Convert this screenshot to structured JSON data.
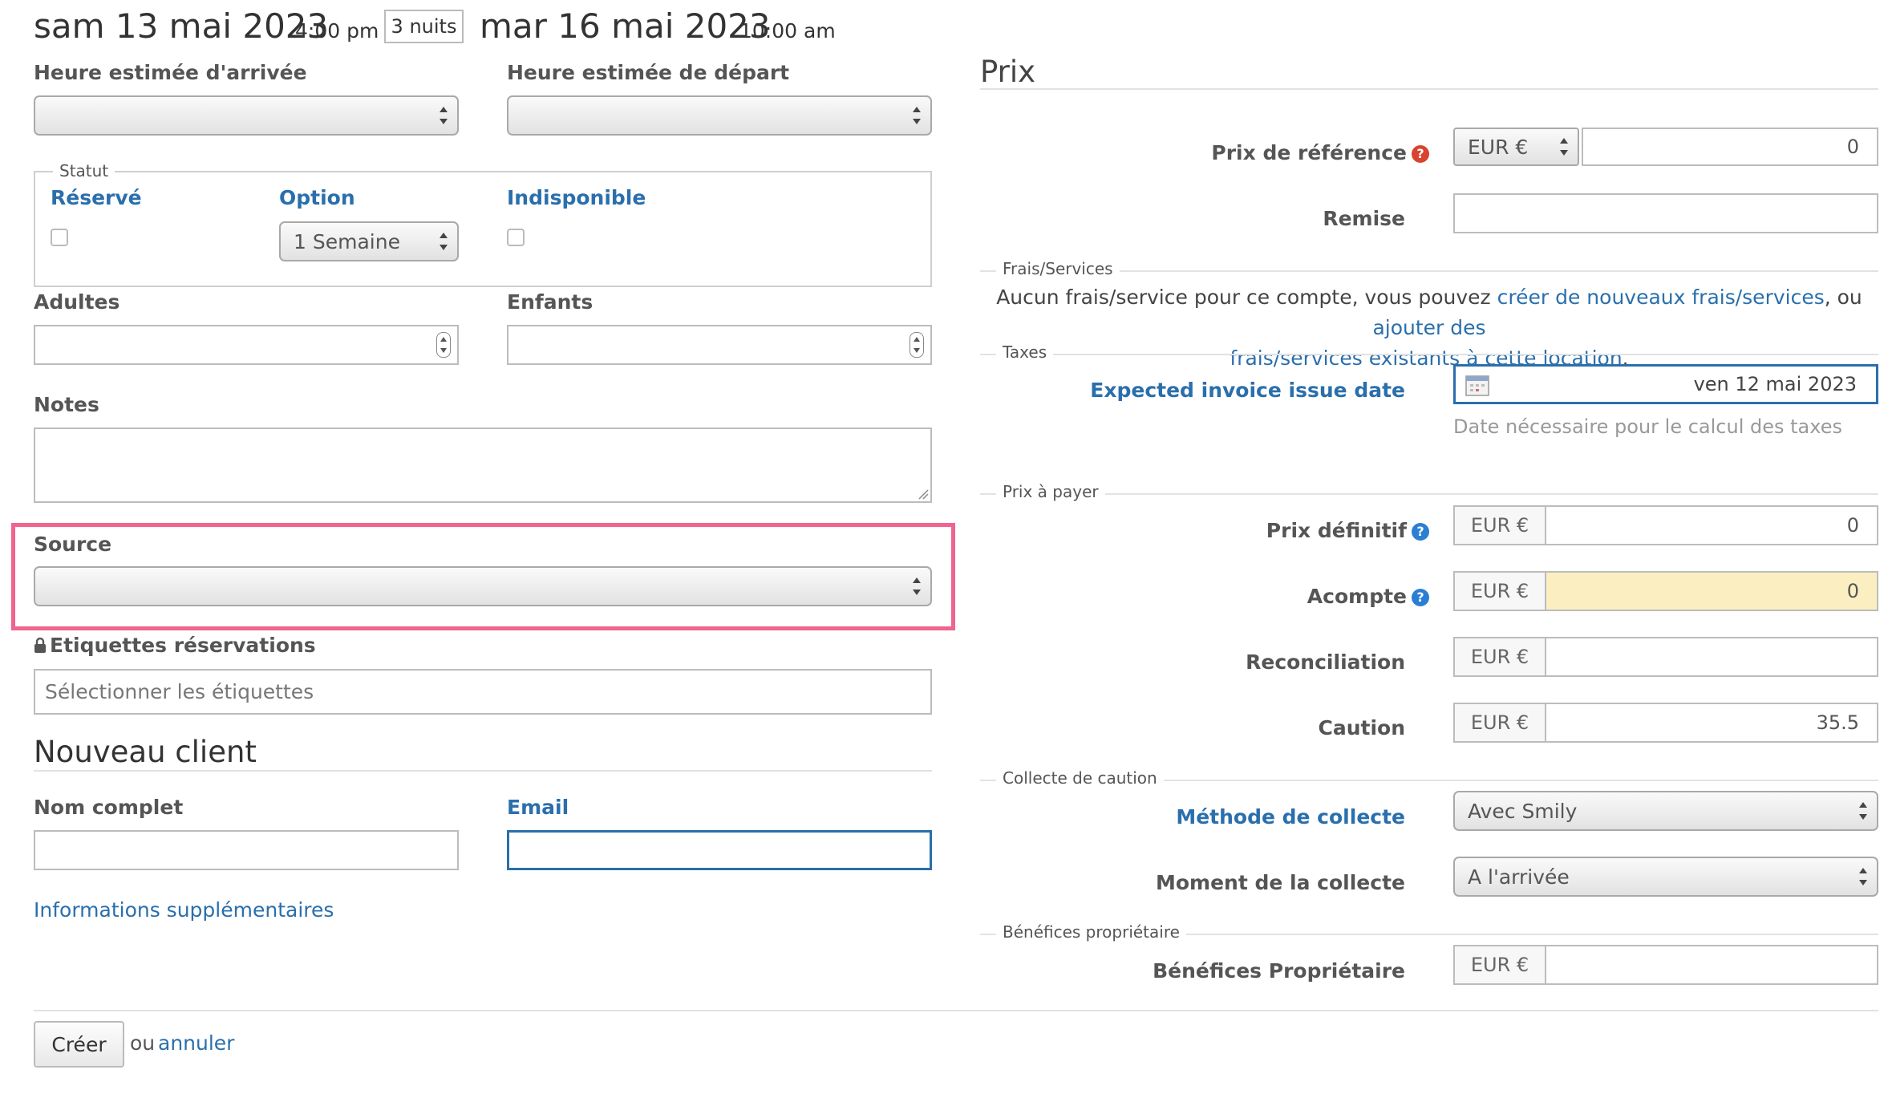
{
  "header": {
    "arrival_date": "sam 13 mai 2023",
    "arrival_time": "4:00 pm",
    "nights": "3 nuits",
    "departure_date": "mar 16 mai 2023",
    "departure_time": "10:00 am"
  },
  "left": {
    "arrival_time_label": "Heure estimée d'arrivée",
    "departure_time_label": "Heure estimée de départ",
    "status_legend": "Statut",
    "status_reserved": "Réservé",
    "status_option": "Option",
    "option_select_value": "1 Semaine",
    "status_unavailable": "Indisponible",
    "adults_label": "Adultes",
    "children_label": "Enfants",
    "notes_label": "Notes",
    "source_label": "Source",
    "tags_label": "Etiquettes réservations",
    "tags_placeholder": "Sélectionner les étiquettes",
    "new_client_title": "Nouveau client",
    "fullname_label": "Nom complet",
    "email_label": "Email",
    "more_info_link": "Informations supplémentaires"
  },
  "footer": {
    "create_button": "Créer",
    "or_text": "ou",
    "cancel_link": "annuler"
  },
  "right": {
    "title": "Prix",
    "ref_price_label": "Prix de référence",
    "ref_currency": "EUR €",
    "ref_price_value": "0",
    "discount_label": "Remise",
    "fees_legend": "Frais/Services",
    "fees_text_1": "Aucun frais/service pour ce compte, vous pouvez ",
    "fees_link_1": "créer de nouveaux frais/services",
    "fees_text_2": ", ou ",
    "fees_link_2a": "ajouter des",
    "fees_link_2b": "frais/services existants à cette location",
    "fees_text_3": ".",
    "taxes_legend": "Taxes",
    "invoice_date_label": "Expected invoice issue date",
    "invoice_date_value": "ven 12 mai 2023",
    "invoice_date_help": "Date nécessaire pour le calcul des taxes",
    "to_pay_legend": "Prix à payer",
    "final_price_label": "Prix définitif",
    "final_price_currency": "EUR €",
    "final_price_value": "0",
    "deposit_label": "Acompte",
    "deposit_currency": "EUR €",
    "deposit_value": "0",
    "reconciliation_label": "Reconciliation",
    "reconciliation_currency": "EUR €",
    "caution_label": "Caution",
    "caution_currency": "EUR €",
    "caution_value": "35.5",
    "collect_legend": "Collecte de caution",
    "collect_method_label": "Méthode de collecte",
    "collect_method_value": "Avec Smily",
    "collect_moment_label": "Moment de la collecte",
    "collect_moment_value": "A l'arrivée",
    "owner_legend": "Bénéfices propriétaire",
    "owner_label": "Bénéfices Propriétaire",
    "owner_currency": "EUR €"
  },
  "colors": {
    "link": "#2a6fac",
    "highlight": "#f0648f",
    "deposit_bg": "#fbefc2"
  }
}
